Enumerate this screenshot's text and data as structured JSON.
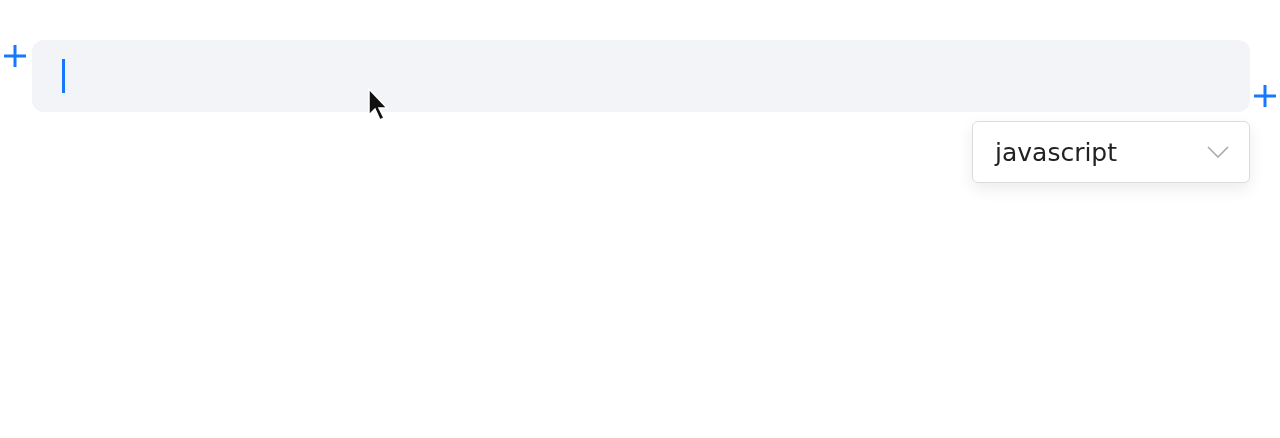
{
  "code_block": {
    "focused": true,
    "language_select": {
      "value": "javascript"
    }
  }
}
